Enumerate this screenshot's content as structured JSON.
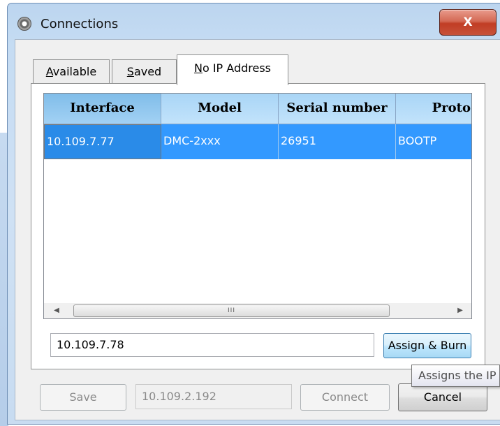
{
  "window": {
    "title": "Connections",
    "close_label": "X"
  },
  "tabs": [
    {
      "label": "Available"
    },
    {
      "label": "Saved"
    },
    {
      "label": "No IP Address"
    }
  ],
  "grid": {
    "columns": [
      "Interface",
      "Model",
      "Serial number",
      "Proto"
    ],
    "rows": [
      [
        "10.109.7.77",
        "DMC-2xxx",
        "26951",
        "BOOTP"
      ]
    ],
    "scroll_thumb_label": "III"
  },
  "ip_input": {
    "value": "10.109.7.78"
  },
  "assign_burn_label": "Assign & Burn",
  "tooltip": "Assigns the IP",
  "footer": {
    "save_label": "Save",
    "address_value": "10.109.2.192",
    "connect_label": "Connect",
    "cancel_label": "Cancel"
  },
  "icons": {
    "app": "gear-icon",
    "scroll_left": "chevron-left-icon",
    "scroll_right": "chevron-right-icon"
  },
  "colors": {
    "selection": "#3399ff",
    "header": "#a9d5f6",
    "close": "#c13d24"
  }
}
